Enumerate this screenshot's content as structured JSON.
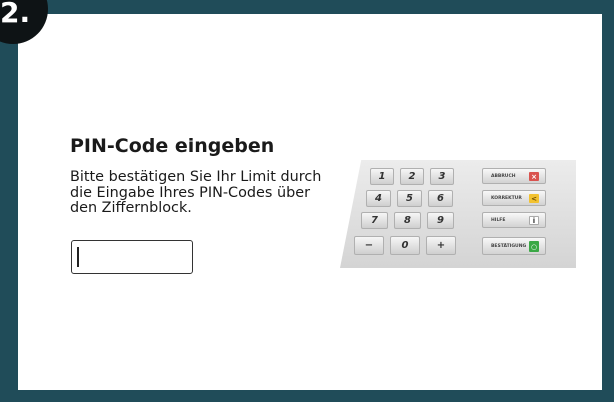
{
  "step": {
    "label": "2."
  },
  "colors": {
    "frame": "#204c59",
    "badge": "#0e1315",
    "abbruch": "#d9534f",
    "korrektur": "#f2c230",
    "hilfe": "#ffffff",
    "bestaetigung": "#3aa845"
  },
  "dialog": {
    "title": "PIN-Code eingeben",
    "description": "Bitte bestätigen Sie Ihr Limit durch die Eingabe Ihres PIN-Codes über den Ziffernblock.",
    "pin_value": ""
  },
  "keypad": {
    "rows": [
      [
        "1",
        "2",
        "3"
      ],
      [
        "4",
        "5",
        "6"
      ],
      [
        "7",
        "8",
        "9"
      ],
      [
        "−",
        "0",
        "+"
      ]
    ],
    "function_keys": [
      {
        "label": "ABBRUCH",
        "symbol": "×",
        "color_key": "abbruch",
        "icon": "cancel-icon"
      },
      {
        "label": "KORREKTUR",
        "symbol": "<",
        "color_key": "korrektur",
        "icon": "correction-icon"
      },
      {
        "label": "HILFE",
        "symbol": "i",
        "color_key": "hilfe",
        "icon": "info-icon"
      },
      {
        "label": "BESTÄTIGUNG",
        "symbol": "○",
        "color_key": "bestaetigung",
        "icon": "confirm-icon"
      }
    ]
  }
}
